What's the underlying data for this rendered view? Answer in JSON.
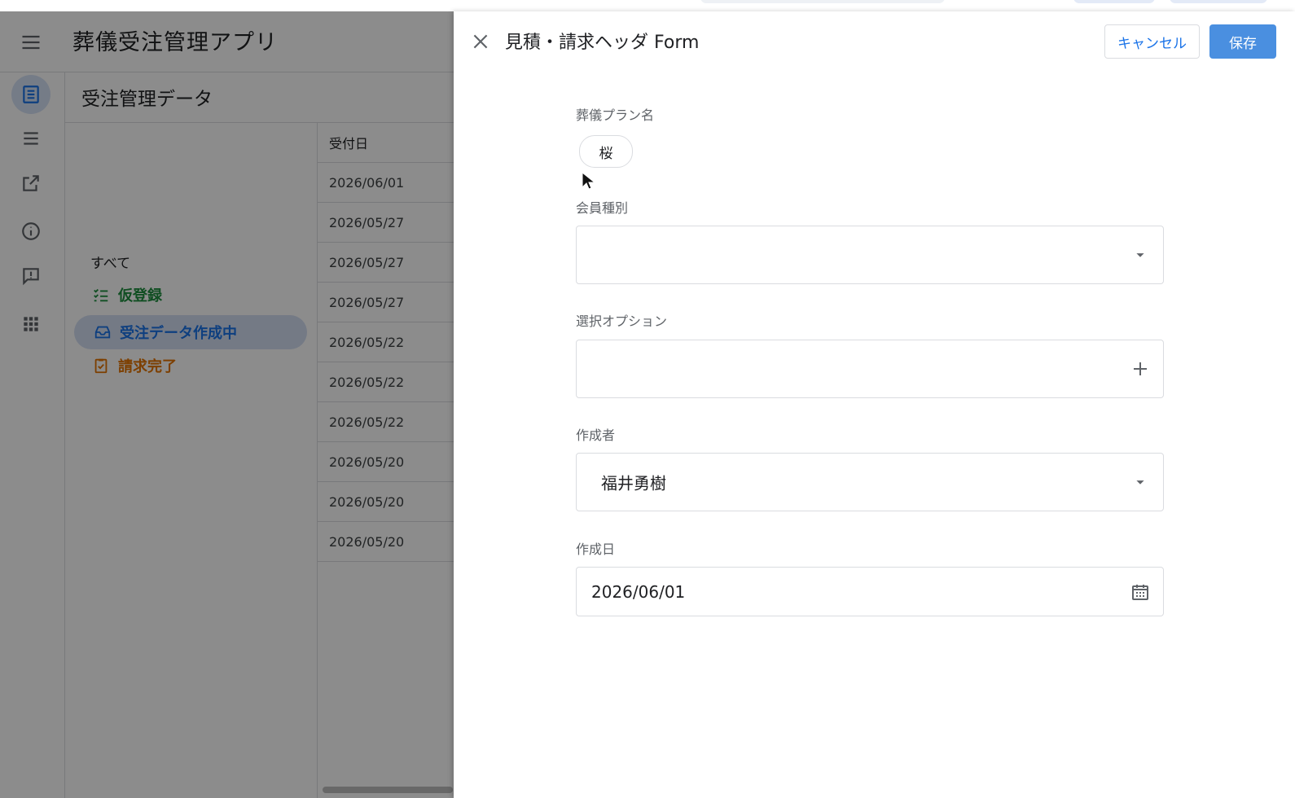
{
  "app": {
    "title": "葬儀受注管理アプリ",
    "content_title": "受注管理データ",
    "filters": [
      {
        "label": "すべて",
        "color": "#202124"
      },
      {
        "label": "仮登録",
        "color": "#1e8e3e"
      },
      {
        "label": "受注データ作成中",
        "color": "#1a73e8"
      },
      {
        "label": "請求完了",
        "color": "#e37400"
      }
    ],
    "table": {
      "column_header": "受付日",
      "rows": [
        "2026/06/01",
        "2026/05/27",
        "2026/05/27",
        "2026/05/27",
        "2026/05/22",
        "2026/05/22",
        "2026/05/22",
        "2026/05/20",
        "2026/05/20",
        "2026/05/20"
      ]
    },
    "rail_icons": [
      "list-view-icon",
      "menu-lines-icon",
      "open-external-icon",
      "info-icon",
      "feedback-icon",
      "apps-grid-icon"
    ]
  },
  "dialog": {
    "title": "見積・請求ヘッダ Form",
    "cancel_label": "キャンセル",
    "save_label": "保存",
    "fields": {
      "plan": {
        "label": "葬儀プラン名",
        "chip": "桜"
      },
      "member_type": {
        "label": "会員種別",
        "value": ""
      },
      "options": {
        "label": "選択オプション",
        "value": ""
      },
      "author": {
        "label": "作成者",
        "value": "福井勇樹"
      },
      "created_date": {
        "label": "作成日",
        "value": "2026/06/01"
      }
    }
  },
  "colors": {
    "accent": "#4a8fe0",
    "accent_text": "#1a73e8"
  }
}
